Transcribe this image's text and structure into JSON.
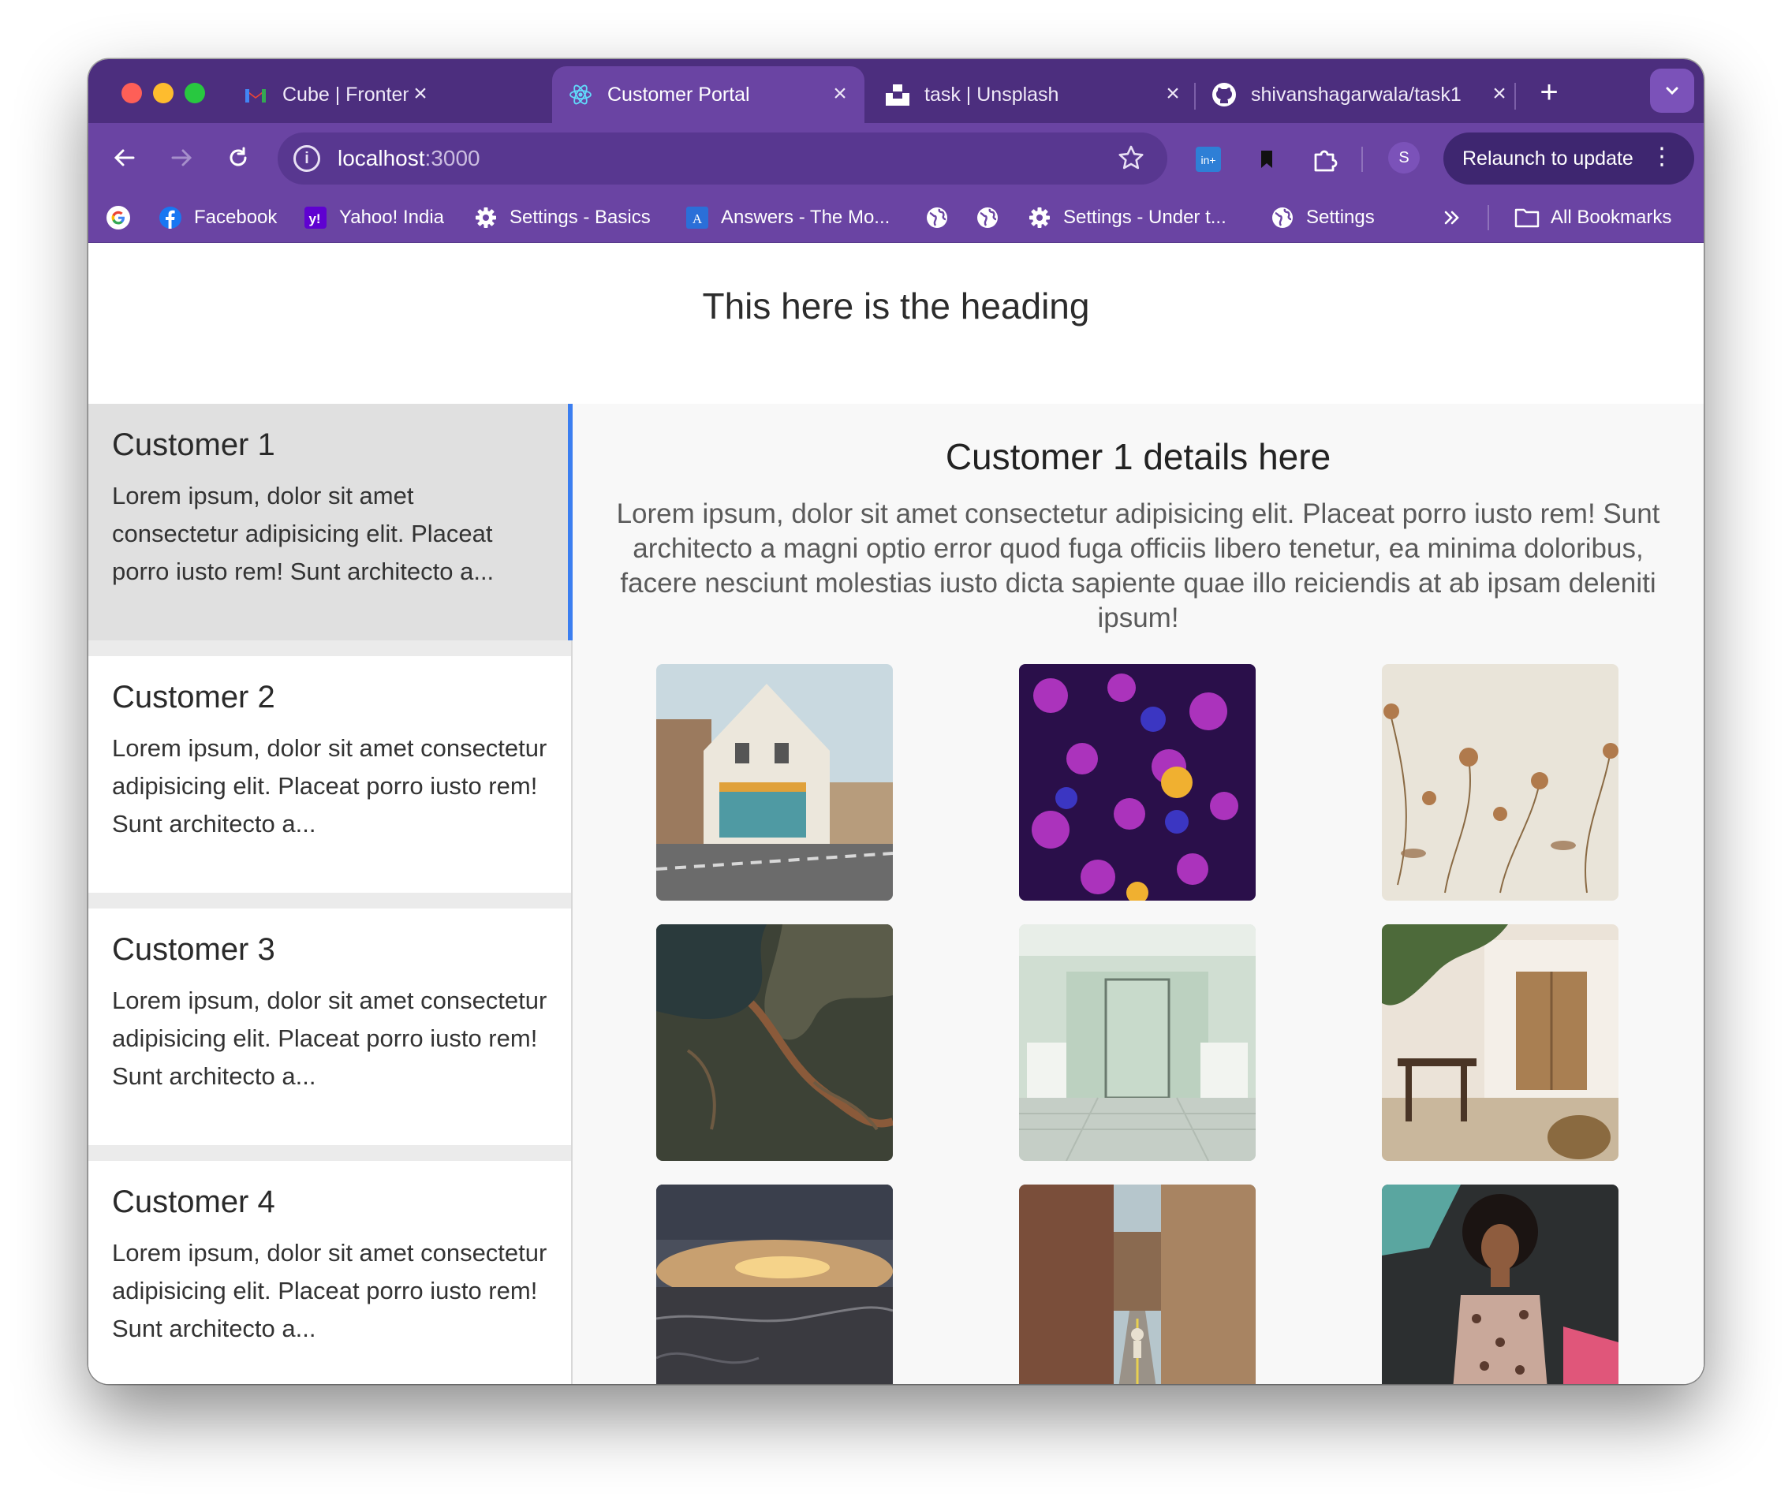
{
  "browser": {
    "tabs": [
      {
        "title": "Cube | Frontend Develo",
        "icon": "gmail-icon",
        "active": false
      },
      {
        "title": "Customer Portal",
        "icon": "react-icon",
        "active": true
      },
      {
        "title": "task | Unsplash",
        "icon": "unsplash-icon",
        "active": false
      },
      {
        "title": "shivanshagarwala/task1",
        "icon": "github-icon",
        "active": false
      }
    ],
    "url_host": "localhost",
    "url_port": ":3000",
    "profile_initial": "S",
    "relaunch_label": "Relaunch to update",
    "bookmarks": [
      {
        "label": "",
        "icon": "google-icon"
      },
      {
        "label": "Facebook",
        "icon": "facebook-icon"
      },
      {
        "label": "Yahoo! India",
        "icon": "yahoo-icon"
      },
      {
        "label": "Settings - Basics",
        "icon": "gear-icon"
      },
      {
        "label": "Answers - The Mo...",
        "icon": "answers-icon"
      },
      {
        "label": "",
        "icon": "globe-icon"
      },
      {
        "label": "",
        "icon": "globe-icon"
      },
      {
        "label": "Settings - Under t...",
        "icon": "gear-icon"
      },
      {
        "label": "Settings",
        "icon": "globe-icon"
      }
    ],
    "all_bookmarks_label": "All Bookmarks"
  },
  "page": {
    "heading": "This here is the heading",
    "customers": [
      {
        "name": "Customer 1",
        "desc": "Lorem ipsum, dolor sit amet consectetur adipisicing elit. Placeat porro iusto rem! Sunt architecto a...",
        "selected": true
      },
      {
        "name": "Customer 2",
        "desc": "Lorem ipsum, dolor sit amet consectetur adipisicing elit. Placeat porro iusto rem! Sunt architecto a...",
        "selected": false
      },
      {
        "name": "Customer 3",
        "desc": "Lorem ipsum, dolor sit amet consectetur adipisicing elit. Placeat porro iusto rem! Sunt architecto a...",
        "selected": false
      },
      {
        "name": "Customer 4",
        "desc": "Lorem ipsum, dolor sit amet consectetur adipisicing elit. Placeat porro iusto rem! Sunt architecto a...",
        "selected": false
      }
    ],
    "details": {
      "title": "Customer 1 details here",
      "body": "Lorem ipsum, dolor sit amet consectetur adipisicing elit. Placeat porro iusto rem! Sunt architecto a magni optio error quod fuga officiis libero tenetur, ea minima doloribus, facere nesciunt molestias iusto dicta sapiente quae illo reiciendis at ab ipsam deleniti ipsum!"
    },
    "photos": [
      {
        "subject": "white-house-street-photo"
      },
      {
        "subject": "purple-bokeh-photo"
      },
      {
        "subject": "pressed-flowers-photo"
      },
      {
        "subject": "aerial-landscape-photo"
      },
      {
        "subject": "green-bathroom-photo"
      },
      {
        "subject": "courtyard-cafe-photo"
      },
      {
        "subject": "sunset-sea-photo"
      },
      {
        "subject": "brick-street-cyclist-photo"
      },
      {
        "subject": "woman-portrait-photo"
      }
    ]
  }
}
